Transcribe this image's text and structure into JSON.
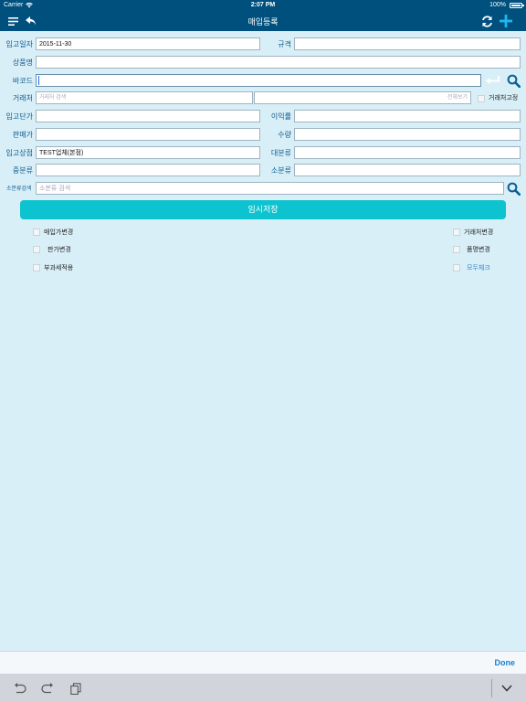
{
  "status_bar": {
    "carrier": "Carrier",
    "time": "2:07 PM",
    "battery": "100%"
  },
  "nav": {
    "title": "매입등록"
  },
  "form": {
    "date": {
      "label": "입고일자",
      "value": "2015-11-30"
    },
    "spec": {
      "label": "규격",
      "value": ""
    },
    "product_name": {
      "label": "상품명",
      "value": ""
    },
    "barcode": {
      "label": "바코드",
      "value": ""
    },
    "supplier": {
      "label": "거래처",
      "placeholder": "거래처 검색",
      "view_placeholder": "전체보기",
      "fix_label": "거래처고정"
    },
    "unit_cost": {
      "label": "입고단가",
      "value": ""
    },
    "margin": {
      "label": "이익률",
      "value": ""
    },
    "sale_price": {
      "label": "판매가",
      "value": ""
    },
    "quantity": {
      "label": "수량",
      "value": ""
    },
    "store": {
      "label": "입고상점",
      "value": "TEST업체(본점)"
    },
    "major_category": {
      "label": "대분류",
      "value": ""
    },
    "middle_category": {
      "label": "중분류",
      "value": ""
    },
    "minor_category": {
      "label": "소분류",
      "value": ""
    },
    "minor_search": {
      "label": "소분류검색",
      "placeholder": "소분류 검색"
    }
  },
  "save_button": "임시저장",
  "checkboxes": {
    "purchase_price_change": "매입가변경",
    "supplier_change": "거래처변경",
    "sale_price_change": "판가변경",
    "product_name_change": "품명변경",
    "vat_apply": "부과세적용",
    "check_all": "모두체크"
  },
  "keyboard_accessory": {
    "done": "Done"
  }
}
